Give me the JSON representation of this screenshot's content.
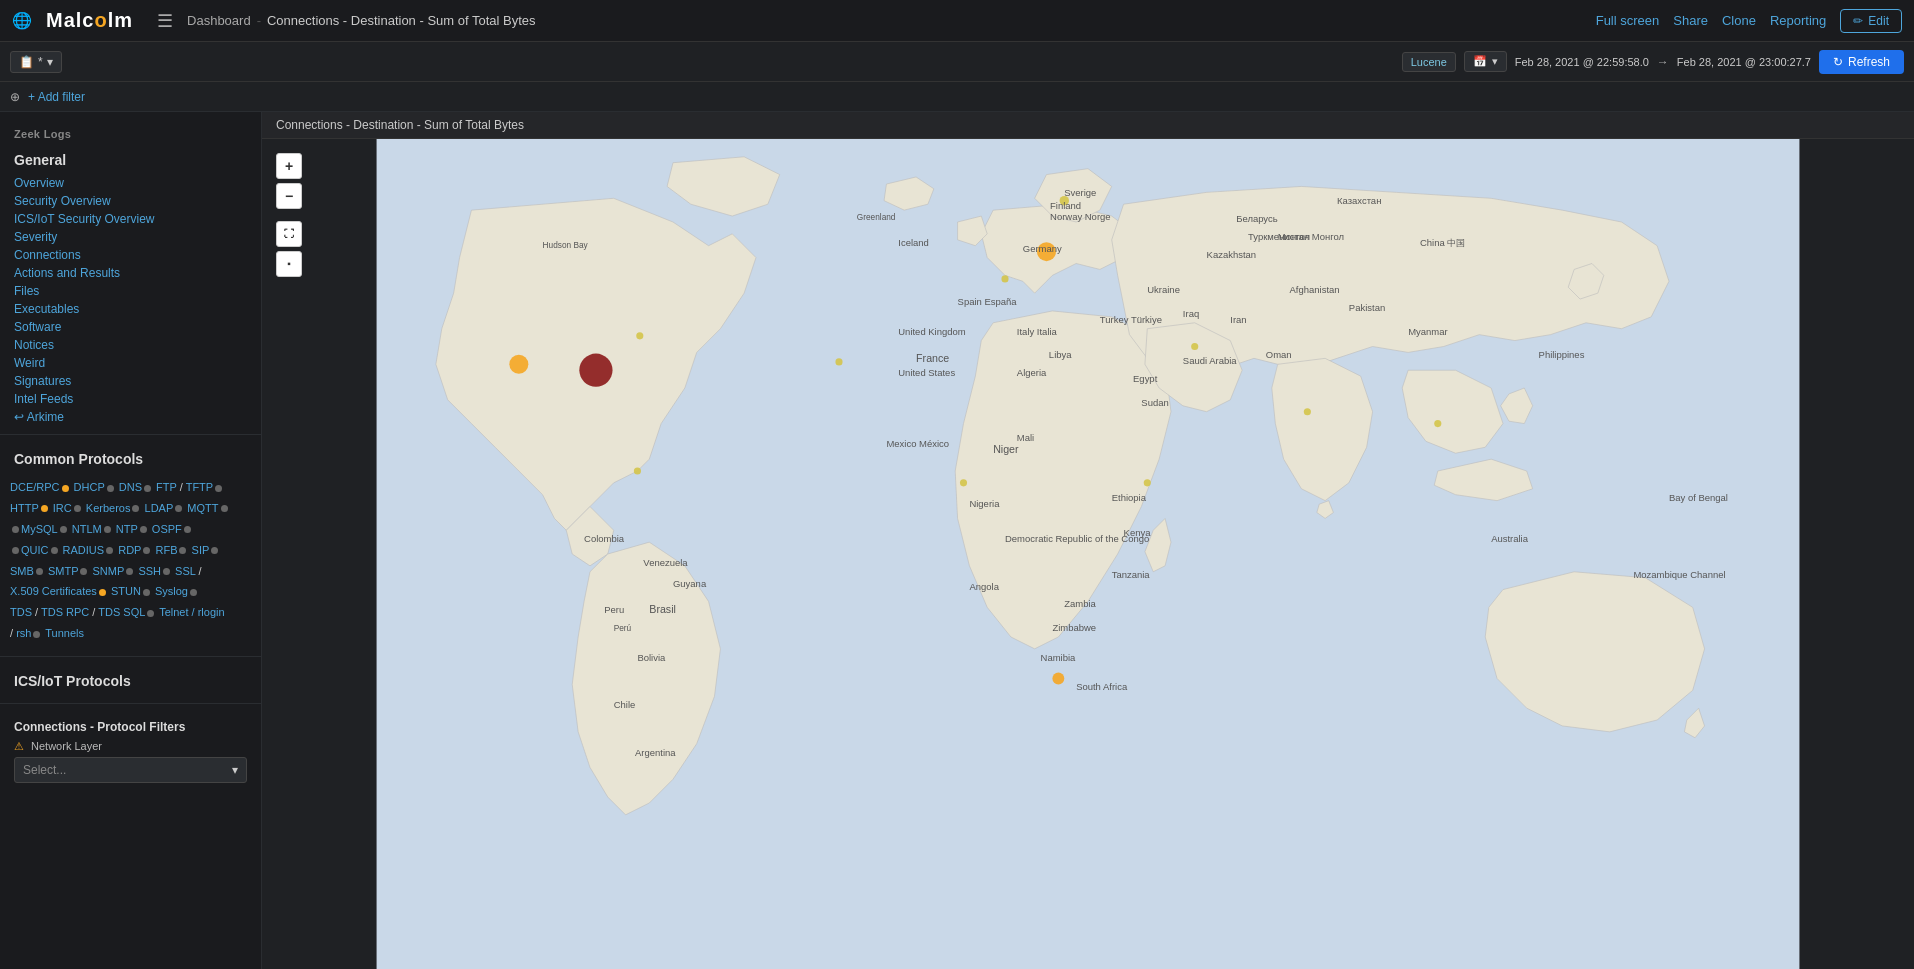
{
  "app": {
    "logo_text": "Malcolm",
    "logo_highlight": "o"
  },
  "top_nav": {
    "menu_icon": "☰",
    "dashboard_label": "Dashboard",
    "breadcrumb_separator": "-",
    "current_page": "Connections - Destination - Sum of Total Bytes",
    "full_screen_label": "Full screen",
    "share_label": "Share",
    "clone_label": "Clone",
    "reporting_label": "Reporting",
    "edit_label": "Edit",
    "edit_icon": "✏",
    "globe_icon": "🌐"
  },
  "filter_bar": {
    "index_selector_value": "*",
    "index_selector_icon": "📋",
    "lucene_label": "Lucene",
    "calendar_icon": "📅",
    "time_from": "Feb 28, 2021 @ 22:59:58.0",
    "time_arrow": "→",
    "time_to": "Feb 28, 2021 @ 23:00:27.7",
    "refresh_label": "Refresh",
    "refresh_icon": "↻"
  },
  "add_filter": {
    "filter_icon": "⊕",
    "add_filter_label": "+ Add filter"
  },
  "sidebar": {
    "section_title": "Zeek Logs",
    "general_title": "General",
    "nav_links": [
      {
        "label": "Overview",
        "id": "overview"
      },
      {
        "label": "Security Overview",
        "id": "security-overview"
      },
      {
        "label": "ICS/IoT Security Overview",
        "id": "ics-security-overview"
      },
      {
        "label": "Severity",
        "id": "severity"
      },
      {
        "label": "Connections",
        "id": "connections"
      },
      {
        "label": "Actions and Results",
        "id": "actions-results"
      },
      {
        "label": "Files",
        "id": "files"
      },
      {
        "label": "Executables",
        "id": "executables"
      },
      {
        "label": "Software",
        "id": "software"
      },
      {
        "label": "Notices",
        "id": "notices"
      },
      {
        "label": "Weird",
        "id": "weird"
      },
      {
        "label": "Signatures",
        "id": "signatures"
      },
      {
        "label": "Intel Feeds",
        "id": "intel-feeds"
      },
      {
        "label": "↩ Arkime",
        "id": "arkime"
      }
    ],
    "common_protocols_title": "Common Protocols",
    "protocols": [
      {
        "label": "DCE/RPC",
        "dot": "orange"
      },
      {
        "label": "DHCP",
        "dot": "gray"
      },
      {
        "label": "DNS",
        "dot": "yellow"
      },
      {
        "label": "FTP",
        "dot": "gray"
      },
      {
        "label": "TFTP",
        "dot": "gray"
      },
      {
        "label": "HTTP",
        "dot": "orange"
      },
      {
        "label": "IRC",
        "dot": "gray"
      },
      {
        "label": "Kerberos",
        "dot": "gray"
      },
      {
        "label": "LDAP",
        "dot": "gray"
      },
      {
        "label": "MQTT",
        "dot": "gray"
      },
      {
        "label": "MySQL",
        "dot": "gray"
      },
      {
        "label": "NTLM",
        "dot": "gray"
      },
      {
        "label": "NTP",
        "dot": "gray"
      },
      {
        "label": "OSPF",
        "dot": "gray"
      },
      {
        "label": "QUIC",
        "dot": "gray"
      },
      {
        "label": "RADIUS",
        "dot": "gray"
      },
      {
        "label": "RDP",
        "dot": "gray"
      },
      {
        "label": "RFB",
        "dot": "gray"
      },
      {
        "label": "SIP",
        "dot": "gray"
      },
      {
        "label": "SMB",
        "dot": "gray"
      },
      {
        "label": "SMTP",
        "dot": "gray"
      },
      {
        "label": "SNMP",
        "dot": "gray"
      },
      {
        "label": "SSH",
        "dot": "gray"
      },
      {
        "label": "SSL",
        "dot": "gray"
      },
      {
        "label": "X.509 Certificates",
        "dot": "orange"
      },
      {
        "label": "STUN",
        "dot": "gray"
      },
      {
        "label": "Syslog",
        "dot": "gray"
      },
      {
        "label": "TDS",
        "dot": "gray"
      },
      {
        "label": "TDS RPC",
        "dot": "gray"
      },
      {
        "label": "TDS SQL",
        "dot": "gray"
      },
      {
        "label": "Telnet / rlogin / rsh",
        "dot": "gray"
      },
      {
        "label": "Tunnels",
        "dot": "gray"
      }
    ],
    "ics_title": "ICS/IoT Protocols",
    "connections_filter_title": "Connections - Protocol Filters",
    "network_layer_label": "Network Layer",
    "select_placeholder": "Select..."
  },
  "map": {
    "title": "Connections - Destination - Sum of Total Bytes",
    "zoom_in": "+",
    "zoom_out": "−",
    "fullscreen_icon": "⛶",
    "collapse_icon": "◼"
  },
  "colors": {
    "accent": "#4ea6dc",
    "brand_orange": "#f5a623",
    "bg_dark": "#1a1b1e",
    "bg_medium": "#1f2124",
    "border": "#333",
    "refresh_blue": "#1f6feb"
  }
}
